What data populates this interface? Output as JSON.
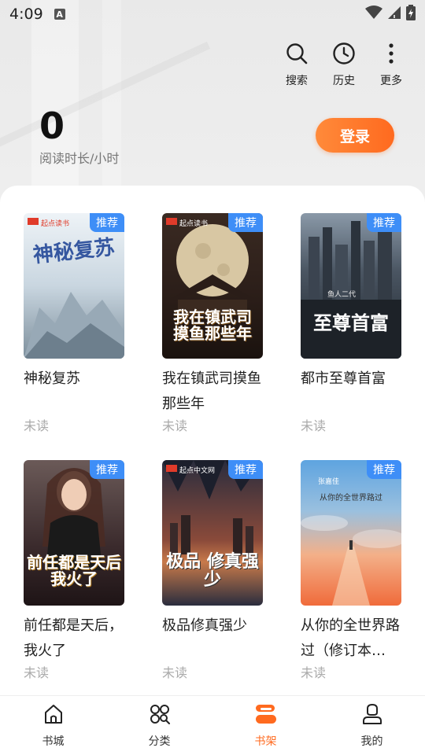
{
  "status_bar": {
    "time": "4:09",
    "a_glyph": "A"
  },
  "header": {
    "actions": [
      {
        "label": "搜索",
        "icon": "search-icon"
      },
      {
        "label": "历史",
        "icon": "clock-icon"
      },
      {
        "label": "更多",
        "icon": "more-vertical-icon"
      }
    ],
    "reading_value": "0",
    "reading_label": "阅读时长/小时",
    "login_label": "登录"
  },
  "books": [
    {
      "title": "神秘复苏",
      "status": "未读",
      "badge": "推荐",
      "cover_text": "神秘复苏",
      "cover_brand": "起点读书",
      "colors": [
        "#dfe8ef",
        "#8fa6b8"
      ]
    },
    {
      "title": "我在镇武司摸鱼那些年",
      "status": "未读",
      "badge": "推荐",
      "cover_text": "我在镇武司 摸鱼那些年",
      "cover_brand": "起点读书",
      "colors": [
        "#2b1f1a",
        "#6b4a2a"
      ]
    },
    {
      "title": "都市至尊首富",
      "status": "未读",
      "badge": "推荐",
      "cover_text": "至尊首富",
      "cover_brand": "鱼人二代",
      "colors": [
        "#2e3440",
        "#5b6470"
      ]
    },
    {
      "title": "前任都是天后，我火了",
      "status": "未读",
      "badge": "推荐",
      "cover_text": "前任都是天后 我火了",
      "cover_brand": "",
      "colors": [
        "#3a2a30",
        "#a27a6a"
      ]
    },
    {
      "title": "极品修真强少",
      "status": "未读",
      "badge": "推荐",
      "cover_text": "极品 修真强少",
      "cover_brand": "起点中文网",
      "colors": [
        "#1e2233",
        "#a84a3a"
      ]
    },
    {
      "title": "从你的全世界路过（修订本…",
      "status": "未读",
      "badge": "推荐",
      "cover_text": "从你的全世界路过",
      "cover_brand": "张嘉佳",
      "colors": [
        "#4a8fd0",
        "#f08a4a"
      ]
    }
  ],
  "bottom_nav": [
    {
      "label": "书城",
      "icon": "home-icon",
      "active": false
    },
    {
      "label": "分类",
      "icon": "category-icon",
      "active": false
    },
    {
      "label": "书架",
      "icon": "bookshelf-icon",
      "active": true
    },
    {
      "label": "我的",
      "icon": "profile-icon",
      "active": false
    }
  ],
  "colors": {
    "accent": "#ff6a1f",
    "badge": "#3e8ef7"
  }
}
